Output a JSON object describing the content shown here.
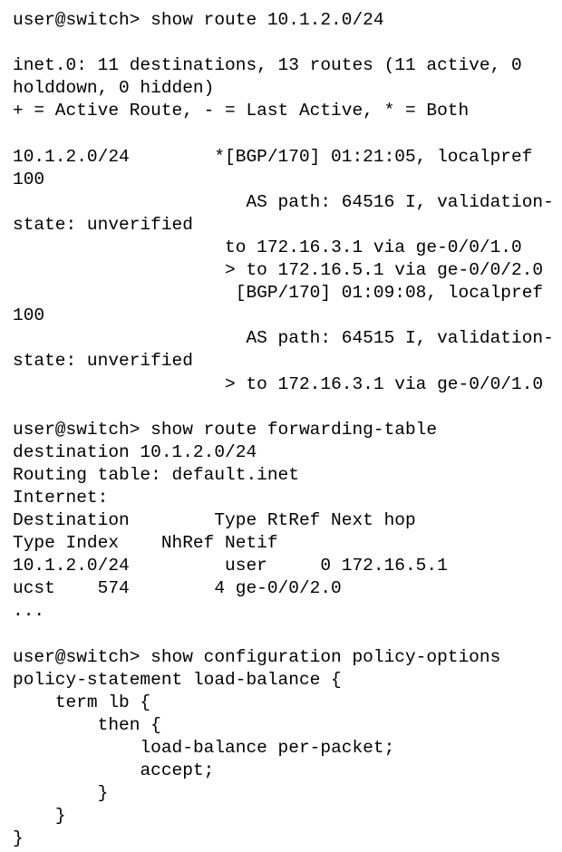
{
  "terminal": {
    "prompt": "user@switch>",
    "foreground_color": "#000000",
    "background_color": "#ffffff",
    "blocks": [
      {
        "name": "show-route-block",
        "command": "user@switch> show route 10.1.2.0/24",
        "lines": [
          "",
          "inet.0: 11 destinations, 13 routes (11 active, 0 holddown, 0 hidden)",
          "+ = Active Route, - = Last Active, * = Both",
          "",
          "10.1.2.0/24        *[BGP/170] 01:21:05, localpref 100",
          "                      AS path: 64516 I, validation-state: unverified",
          "                    to 172.16.3.1 via ge-0/0/1.0",
          "                    > to 172.16.5.1 via ge-0/0/2.0",
          "                     [BGP/170] 01:09:08, localpref 100",
          "                      AS path: 64515 I, validation-state: unverified",
          "                    > to 172.16.3.1 via ge-0/0/1.0",
          ""
        ]
      },
      {
        "name": "show-route-forwarding-table-block",
        "command": "user@switch> show route forwarding-table destination 10.1.2.0/24",
        "lines": [
          "Routing table: default.inet",
          "Internet:",
          "Destination        Type RtRef Next hop           Type Index    NhRef Netif",
          "10.1.2.0/24         user     0 172.16.5.1        ucst    574        4 ge-0/0/2.0",
          "...",
          ""
        ]
      },
      {
        "name": "show-configuration-block",
        "command": "user@switch> show configuration policy-options",
        "lines": [
          "policy-statement load-balance {",
          "    term lb {",
          "        then {",
          "            load-balance per-packet;",
          "            accept;",
          "        }",
          "    }",
          "}"
        ]
      }
    ],
    "route_table": {
      "protocol_family": "inet.0",
      "destinations": 11,
      "routes": 13,
      "active": 11,
      "holddown": 0,
      "hidden": 0,
      "legend": {
        "plus": "Active Route",
        "minus": "Last Active",
        "asterisk": "Both"
      },
      "entries": [
        {
          "prefix": "10.1.2.0/24",
          "state_flag": "*",
          "protocol": "BGP",
          "preference": "170",
          "age": "01:21:05",
          "localpref": "100",
          "as_path": "64516 I",
          "validation_state": "unverified",
          "next_hops": [
            {
              "selected": false,
              "address": "172.16.3.1",
              "interface": "ge-0/0/1.0"
            },
            {
              "selected": true,
              "address": "172.16.5.1",
              "interface": "ge-0/0/2.0"
            }
          ]
        },
        {
          "prefix": "",
          "state_flag": "",
          "protocol": "BGP",
          "preference": "170",
          "age": "01:09:08",
          "localpref": "100",
          "as_path": "64515 I",
          "validation_state": "unverified",
          "next_hops": [
            {
              "selected": true,
              "address": "172.16.3.1",
              "interface": "ge-0/0/1.0"
            }
          ]
        }
      ]
    },
    "forwarding_table": {
      "routing_table": "default.inet",
      "family": "Internet:",
      "columns": [
        "Destination",
        "Type",
        "RtRef",
        "Next hop",
        "Type",
        "Index",
        "NhRef",
        "Netif"
      ],
      "rows": [
        {
          "destination": "10.1.2.0/24",
          "type": "user",
          "rtref": "0",
          "next_hop": "172.16.5.1",
          "nh_type": "ucst",
          "index": "574",
          "nhref": "4",
          "netif": "ge-0/0/2.0"
        }
      ],
      "truncation_marker": "..."
    },
    "configuration": {
      "hierarchy": "policy-options",
      "policy_statement": "load-balance",
      "term": "lb",
      "action_block": "then",
      "actions": [
        "load-balance per-packet;",
        "accept;"
      ]
    }
  }
}
